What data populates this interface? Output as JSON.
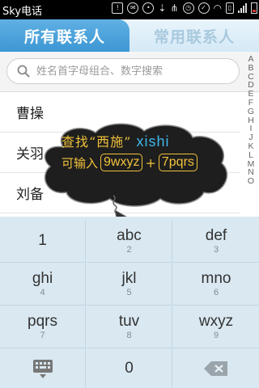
{
  "status_bar": {
    "carrier": "Sky电话",
    "icons": [
      "notification-icon",
      "sms-icon",
      "alarm-icon",
      "usb-icon",
      "share-icon",
      "clock-icon",
      "check-icon",
      "wifi-icon",
      "vibrate-icon",
      "signal-icon",
      "battery-icon"
    ]
  },
  "tabs": [
    {
      "label": "所有联系人",
      "active": true
    },
    {
      "label": "常用联系人",
      "active": false
    }
  ],
  "search": {
    "placeholder": "姓名首字母组合、数字搜索",
    "value": ""
  },
  "contacts": [
    {
      "name": "曹操"
    },
    {
      "name": "关羽"
    },
    {
      "name": "刘备"
    }
  ],
  "alphabet_index": [
    "A",
    "B",
    "C",
    "D",
    "E",
    "F",
    "G",
    "H",
    "I",
    "J",
    "K",
    "L",
    "M",
    "N",
    "O"
  ],
  "tooltip": {
    "line1_prefix": "查找“西施”",
    "line1_keyword": "xishi",
    "line2_prefix": "可输入",
    "code1": "9wxyz",
    "plus": "+",
    "code2": "7pqrs"
  },
  "keypad": [
    {
      "main": "1",
      "sub": ""
    },
    {
      "main": "abc",
      "sub": "2"
    },
    {
      "main": "def",
      "sub": "3"
    },
    {
      "main": "ghi",
      "sub": "4"
    },
    {
      "main": "jkl",
      "sub": "5"
    },
    {
      "main": "mno",
      "sub": "6"
    },
    {
      "main": "pqrs",
      "sub": "7"
    },
    {
      "main": "tuv",
      "sub": "8"
    },
    {
      "main": "wxyz",
      "sub": "9"
    },
    {
      "main": "",
      "sub": ""
    },
    {
      "main": "0",
      "sub": ""
    },
    {
      "main": "",
      "sub": ""
    }
  ],
  "colors": {
    "tab_active": "#4aa3dc",
    "keypad_bg": "#d9e8f1",
    "tooltip_text": "#f2c23b",
    "tooltip_keyword": "#3fb7ec"
  }
}
